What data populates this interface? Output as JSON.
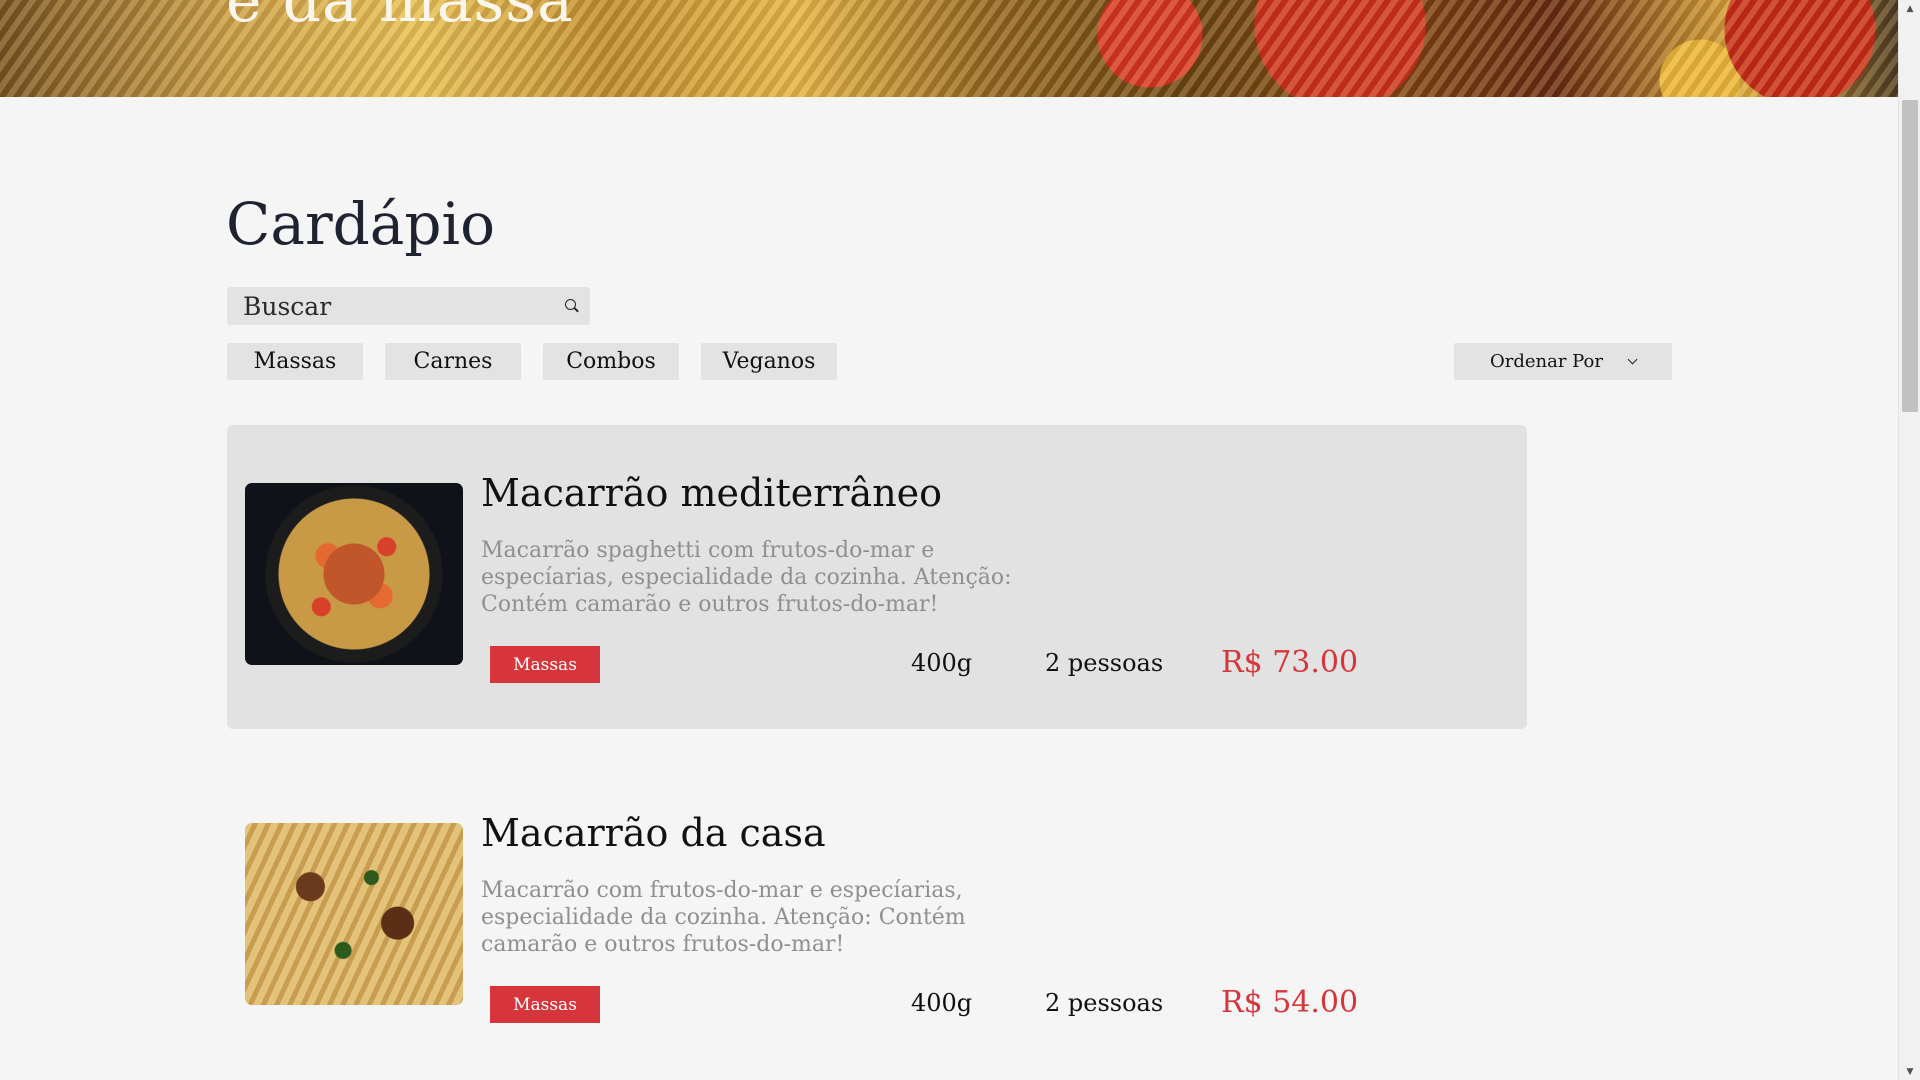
{
  "hero": {
    "title": "e da massa"
  },
  "menu": {
    "title": "Cardápio",
    "search_placeholder": "Buscar",
    "filters": [
      "Massas",
      "Carnes",
      "Combos",
      "Veganos"
    ],
    "sort_label": "Ordenar Por"
  },
  "items": [
    {
      "name": "Macarrão mediterrâneo",
      "description": "Macarrão spaghetti com frutos-do-mar e especíarias, especialidade da cozinha. Atenção: Contém camarão e outros frutos-do-mar!",
      "category": "Massas",
      "weight": "400g",
      "serves": "2 pessoas",
      "price": "R$ 73.00",
      "image_icon": "pasta-seafood-photo"
    },
    {
      "name": "Macarrão da casa",
      "description": "Macarrão com frutos-do-mar e especíarias, especialidade da cozinha. Atenção: Contém camarão e outros frutos-do-mar!",
      "category": "Massas",
      "weight": "400g",
      "serves": "2 pessoas",
      "price": "R$ 54.00",
      "image_icon": "pasta-house-photo"
    }
  ],
  "colors": {
    "background": "#f5f5f5",
    "card_highlight": "#e2e2e2",
    "accent": "#d6363b",
    "button_bg": "#e3e3e3",
    "muted_text": "#8f8f8f"
  }
}
